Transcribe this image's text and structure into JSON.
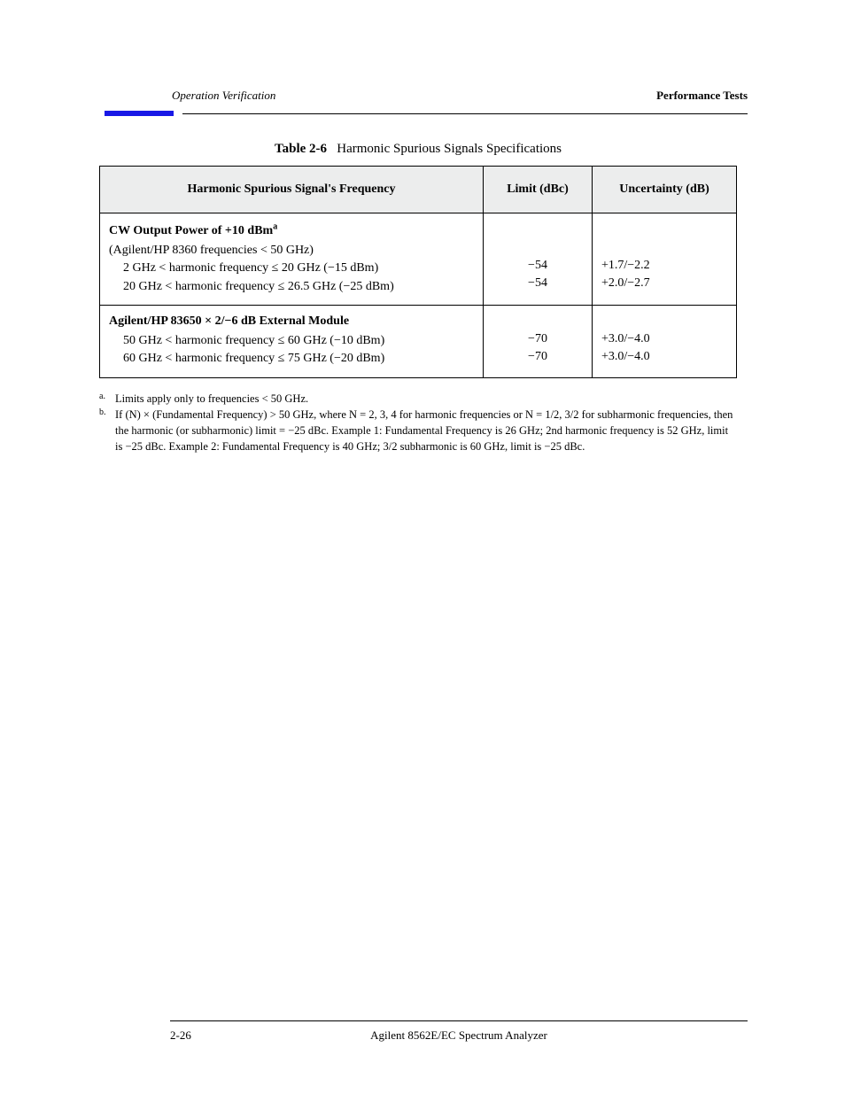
{
  "header": {
    "left_italic": "Operation Verification",
    "right_bold": "Performance Tests"
  },
  "table": {
    "caption_prefix": "Table 2-6",
    "caption_text": "Harmonic Spurious Signals Specifications",
    "cols": {
      "c1": "Harmonic Spurious Signal's Frequency",
      "c2": "Limit (dBc)",
      "c3": "Uncertainty (dB)"
    },
    "block1": {
      "title_html": "CW Output Power of +10 dBm<sup>a</sup>",
      "note": "(Agilent/HP 8360 frequencies < 50 GHz)",
      "r1": {
        "c1": "2 GHz < harmonic frequency ≤ 20 GHz (−15 dBm)",
        "c2": "−54",
        "c3": "+1.7/−2.2"
      },
      "r2": {
        "c1": "20 GHz < harmonic frequency ≤ 26.5 GHz (−25 dBm)",
        "c2": "−54",
        "c3": "+2.0/−2.7"
      }
    },
    "block2": {
      "title": "Agilent/HP 83650 × 2/−6 dB External Module",
      "r1": {
        "c1": "50 GHz < harmonic frequency ≤ 60 GHz (−10 dBm)",
        "c2": "−70",
        "c3": "+3.0/−4.0"
      },
      "r2": {
        "c1": "60 GHz < harmonic frequency ≤ 75 GHz (−20 dBm)",
        "c2": "−70",
        "c3": "+3.0/−4.0"
      }
    }
  },
  "footnotes": {
    "a": "Limits apply only to frequencies < 50 GHz.",
    "b_html": "If (N) × (Fundamental Frequency) > 50 GHz, where N = 2, 3, 4 for harmonic frequencies or N = 1/2, 3/2 for subharmonic frequencies, then the harmonic (or subharmonic) limit = −25 dBc. Example 1: Fundamental Frequency is 26 GHz; 2nd harmonic frequency is 52 GHz, limit is −25 dBc. Example 2: Fundamental Frequency is 40 GHz; 3/2 subharmonic is 60 GHz, limit is −25 dBc."
  },
  "footer": {
    "left": "2-26",
    "mid": "Agilent 8562E/EC Spectrum Analyzer",
    "right": ""
  }
}
